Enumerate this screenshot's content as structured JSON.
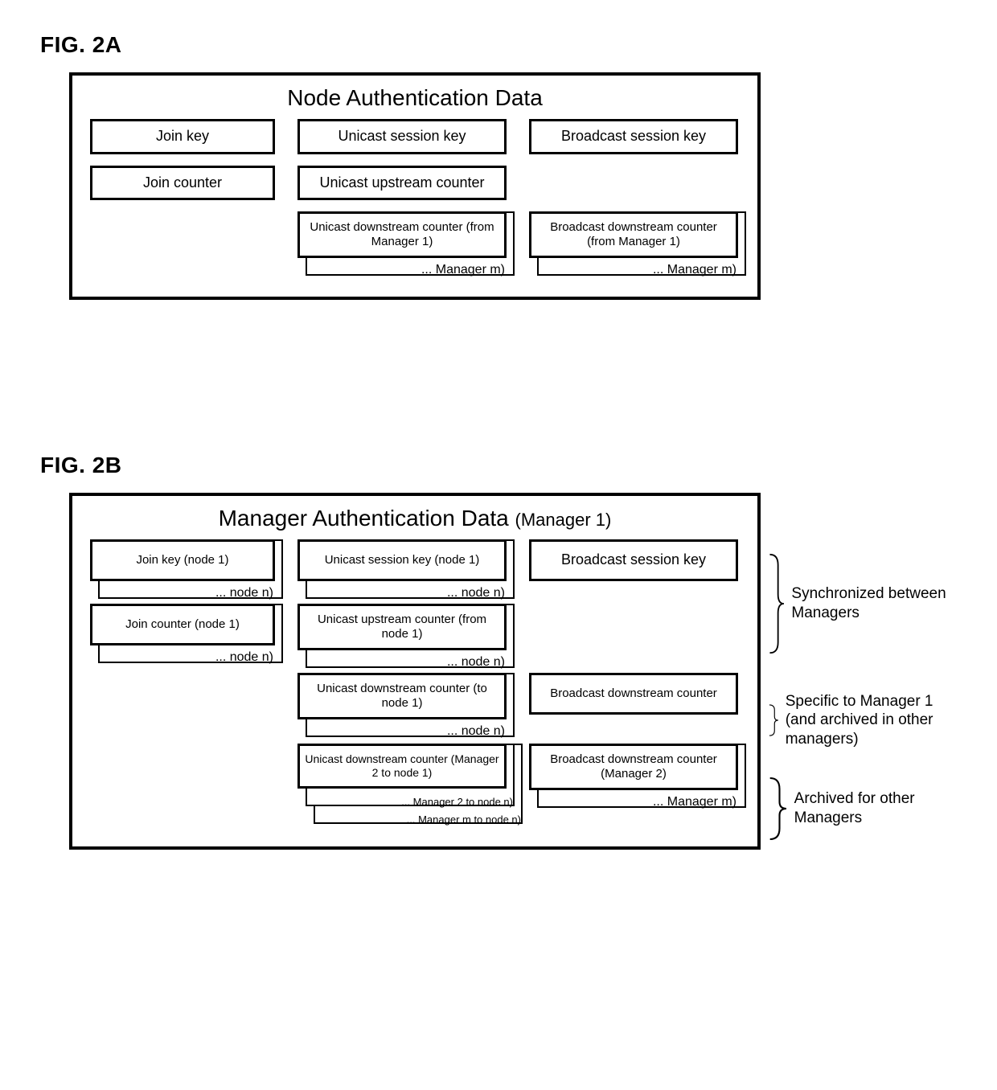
{
  "figA": {
    "label": "FIG. 2A",
    "title": "Node Authentication Data",
    "row1": {
      "c1": "Join key",
      "c2": "Unicast session key",
      "c3": "Broadcast session key"
    },
    "row2": {
      "c1": "Join counter",
      "c2": "Unicast upstream counter"
    },
    "row3": {
      "c2": {
        "main": "Unicast downstream counter (from Manager 1)",
        "sub": "... Manager m)"
      },
      "c3": {
        "main": "Broadcast downstream counter (from Manager 1)",
        "sub": "... Manager m)"
      }
    }
  },
  "figB": {
    "label": "FIG. 2B",
    "title": "Manager Authentication Data",
    "title_sub": "(Manager 1)",
    "row1": {
      "c1": {
        "main": "Join key (node 1)",
        "sub": "... node n)"
      },
      "c2": {
        "main": "Unicast session key (node 1)",
        "sub": "... node n)"
      },
      "c3": "Broadcast session key"
    },
    "row2": {
      "c1": {
        "main": "Join counter (node 1)",
        "sub": "... node n)"
      },
      "c2": {
        "main": "Unicast upstream counter (from node 1)",
        "sub": "... node n)"
      }
    },
    "row3": {
      "c2": {
        "main": "Unicast downstream counter (to node 1)",
        "sub": "... node n)"
      },
      "c3": "Broadcast downstream counter"
    },
    "row4": {
      "c2": {
        "main": "Unicast downstream counter (Manager 2 to node 1)",
        "sub1": "... Manager 2 to node n)",
        "sub2": "... Manager m to node n)"
      },
      "c3": {
        "main": "Broadcast downstream counter (Manager 2)",
        "sub": "... Manager m)"
      }
    },
    "side": {
      "g1": "Synchronized between Managers",
      "g2": "Specific to Manager 1 (and archived in other managers)",
      "g3": "Archived for other Managers"
    }
  }
}
